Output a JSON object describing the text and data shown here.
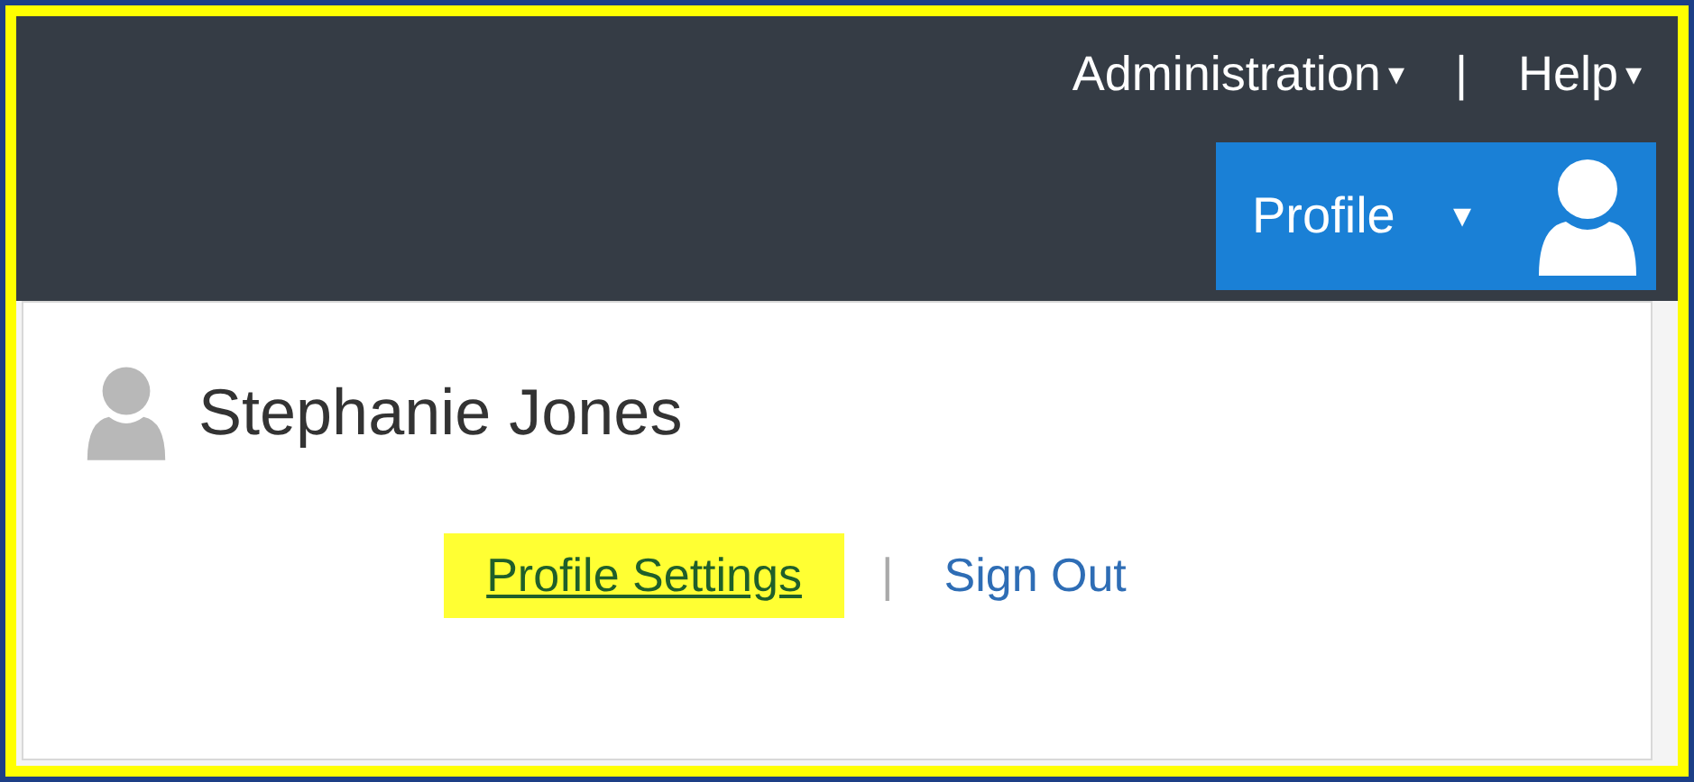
{
  "header": {
    "menus": [
      {
        "label": "Administration",
        "caret": "▾"
      },
      {
        "label": "|",
        "kind": "separator"
      },
      {
        "label": "Help",
        "caret": "▾"
      }
    ],
    "profile_button": {
      "label": "Profile",
      "caret": "▾"
    }
  },
  "dropdown": {
    "name": "Stephanie Jones",
    "links": [
      {
        "label": "Profile Settings",
        "highlighted": true
      },
      {
        "label": "Sign Out",
        "highlighted": false
      }
    ],
    "separator": "|"
  }
}
